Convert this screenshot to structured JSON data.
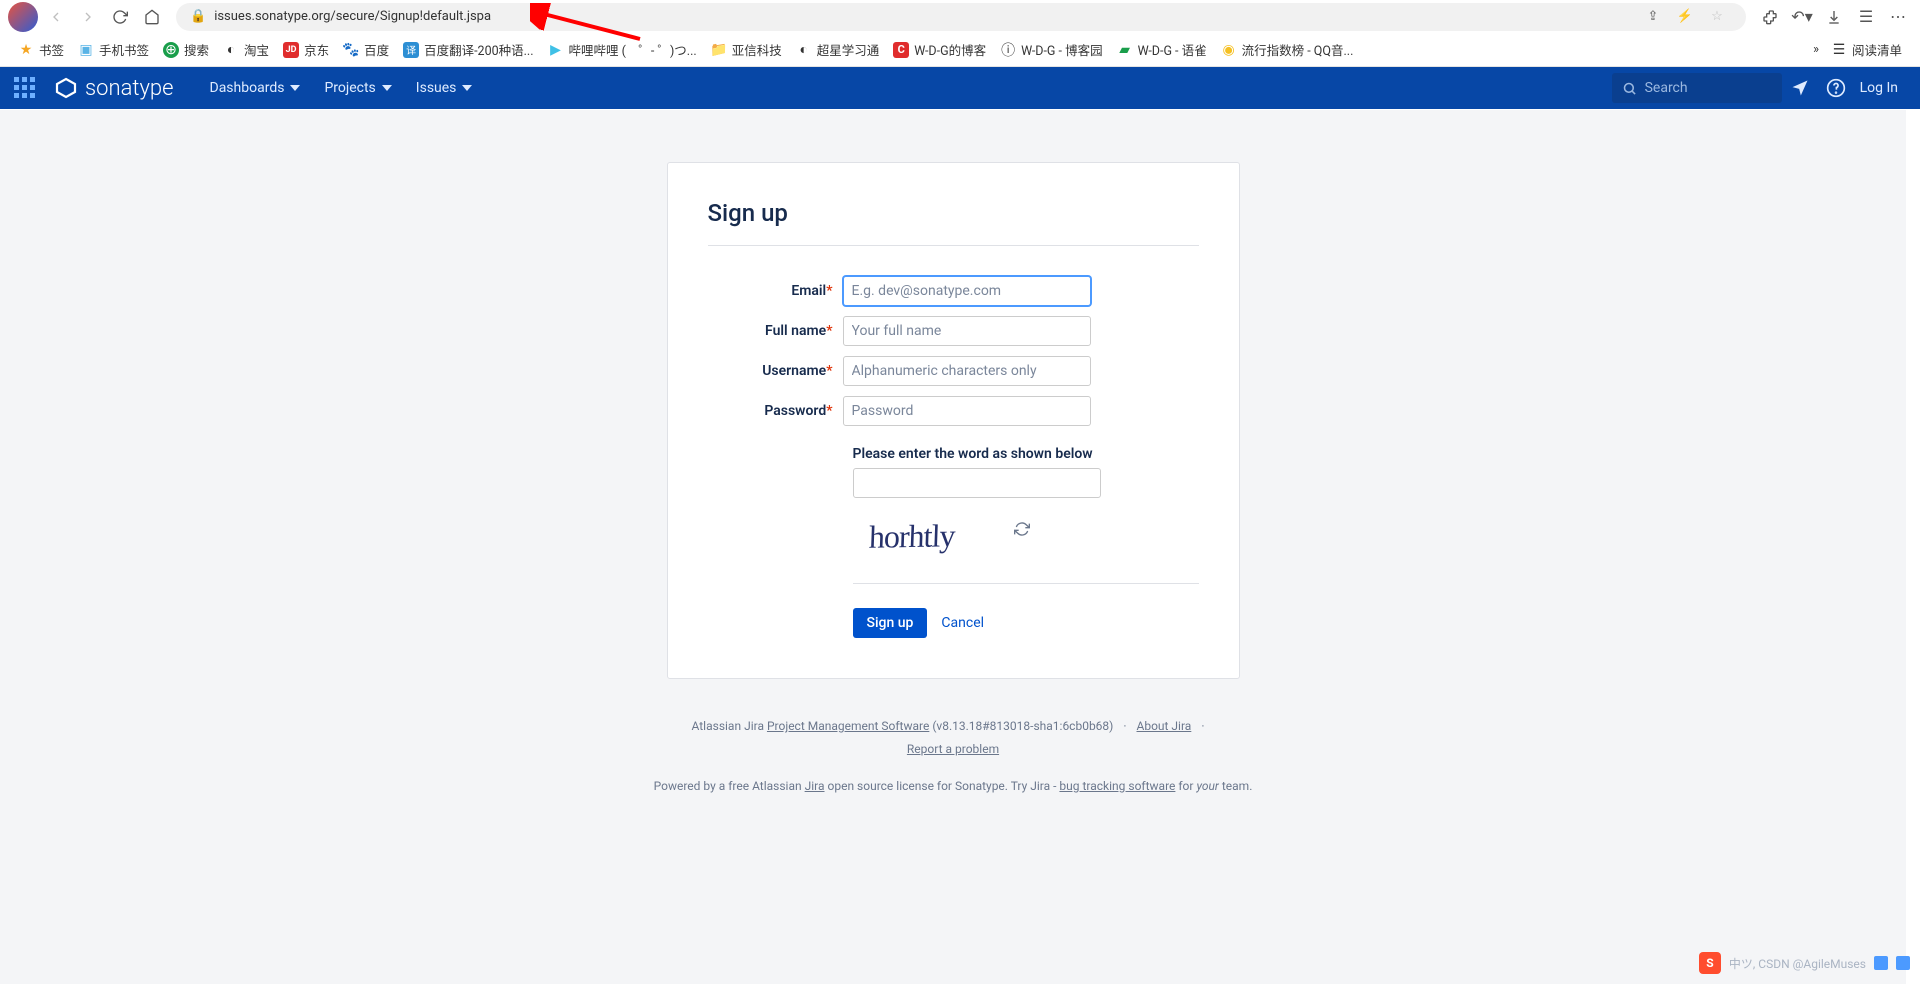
{
  "browser": {
    "url": "issues.sonatype.org/secure/Signup!default.jspa"
  },
  "bookmarks": [
    {
      "label": "书签",
      "color": "#f5a623"
    },
    {
      "label": "手机书签",
      "color": "#5ab4e6"
    },
    {
      "label": "搜索",
      "color": "#1a9e4b"
    },
    {
      "label": "淘宝",
      "color": "#333"
    },
    {
      "label": "京东",
      "color": "#e02d2d",
      "bg": "#e02d2d",
      "txt": "JD"
    },
    {
      "label": "百度",
      "color": "#2d5cd4"
    },
    {
      "label": "百度翻译-200种语...",
      "color": "#2d8fd4",
      "bg": "#2d8fd4",
      "txt": "译"
    },
    {
      "label": "哔哩哔哩 (　゜- ゜)つ...",
      "color": "#3fc0e6"
    },
    {
      "label": "亚信科技",
      "color": "#f5a623"
    },
    {
      "label": "超星学习通",
      "color": "#333"
    },
    {
      "label": "W-D-G的博客",
      "color": "#e02d2d",
      "bg": "#e02d2d",
      "txt": "C"
    },
    {
      "label": "W-D-G - 博客园",
      "color": "#333"
    },
    {
      "label": "W-D-G - 语雀",
      "color": "#1a9e4b"
    },
    {
      "label": "流行指数榜 - QQ音...",
      "color": "#f5c023"
    }
  ],
  "bm_right": {
    "more": "»",
    "reading": "阅读清单"
  },
  "nav": {
    "brand": "sonatype",
    "items": [
      "Dashboards",
      "Projects",
      "Issues"
    ],
    "search_placeholder": "Search",
    "login": "Log In"
  },
  "form": {
    "title": "Sign up",
    "email_label": "Email",
    "email_ph": "E.g. dev@sonatype.com",
    "fullname_label": "Full name",
    "fullname_ph": "Your full name",
    "username_label": "Username",
    "username_ph": "Alphanumeric characters only",
    "password_label": "Password",
    "password_ph": "Password",
    "captcha_label": "Please enter the word as shown below",
    "captcha_text": "horhtly",
    "submit": "Sign up",
    "cancel": "Cancel"
  },
  "footer": {
    "line1_a": "Atlassian Jira ",
    "line1_link": "Project Management Software",
    "line1_b": " (v8.13.18#813018-sha1:6cb0b68)",
    "about": "About Jira",
    "report": "Report a problem",
    "line2_a": "Powered by a free Atlassian ",
    "jira": "Jira",
    "line2_b": " open source license for Sonatype. Try Jira - ",
    "bts": "bug tracking software",
    "line2_c": " for ",
    "your": "your",
    "line2_d": " team."
  },
  "ime": {
    "s": "S",
    "txt": "中ツ, CSDN @AgileMuses"
  }
}
